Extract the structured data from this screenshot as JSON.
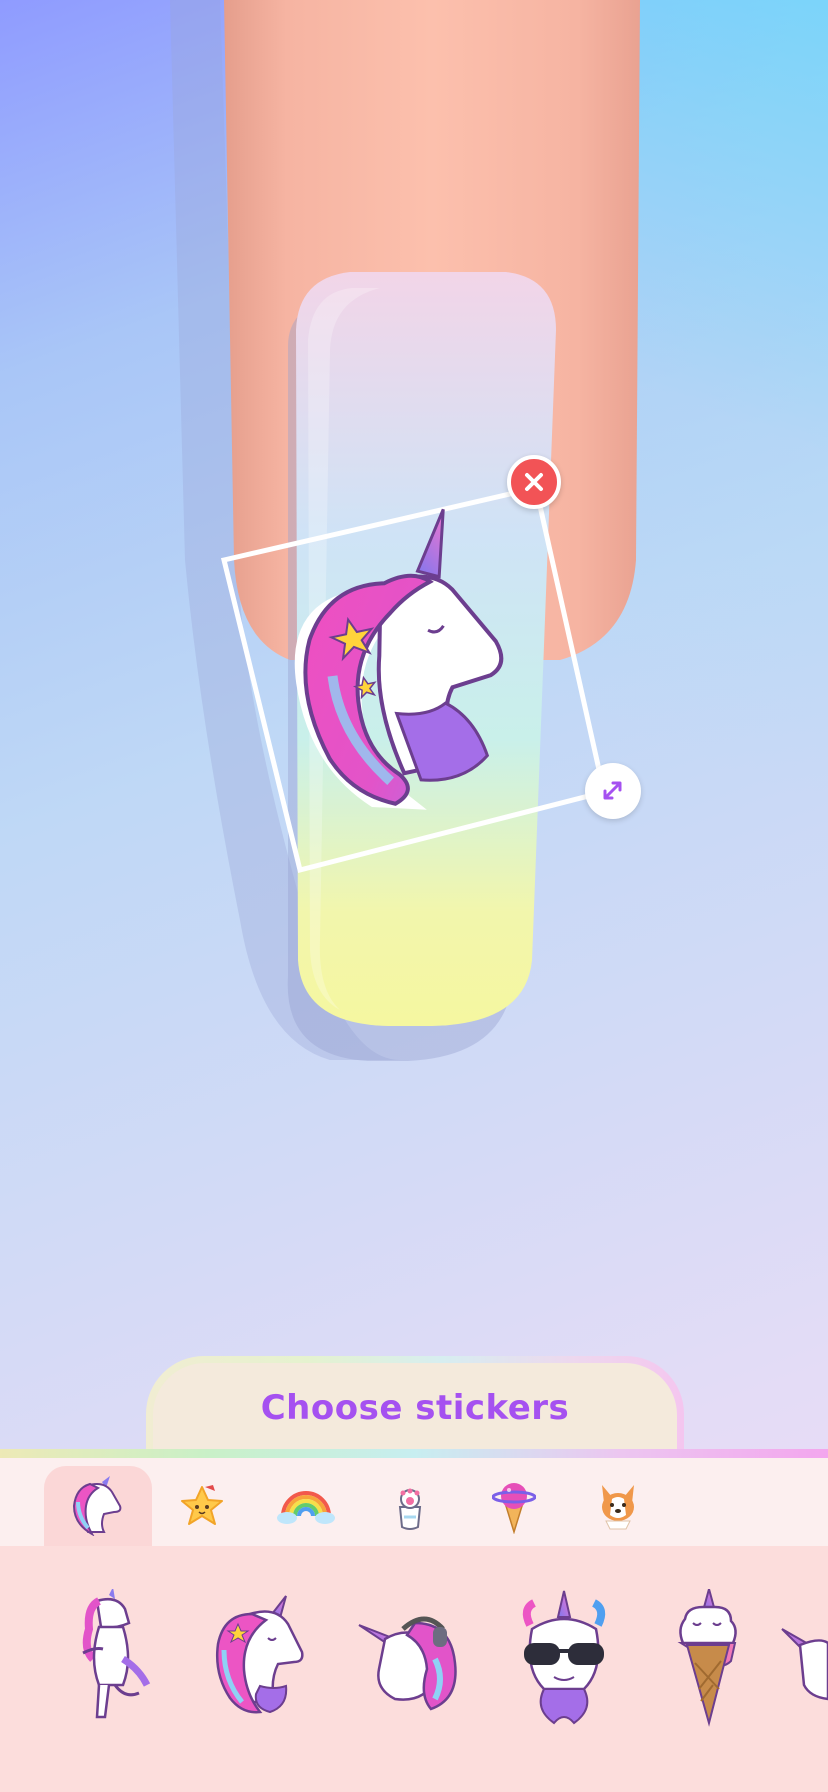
{
  "title": "Choose stickers",
  "colors": {
    "accent": "#a551f0",
    "delete": "#f25356",
    "panel_bg": "#fcdddc",
    "category_bar_bg": "#fcefef",
    "active_tab_bg": "#fbd7d7"
  },
  "editor": {
    "selected_sticker": "unicorn-head-icon",
    "delete_icon": "close-icon",
    "resize_icon": "resize-arrows-icon"
  },
  "categories": [
    {
      "icon": "unicorn-icon",
      "active": true
    },
    {
      "icon": "star-face-icon",
      "active": false
    },
    {
      "icon": "rainbow-icon",
      "active": false
    },
    {
      "icon": "paw-icon",
      "active": false
    },
    {
      "icon": "planet-icecream-icon",
      "active": false
    },
    {
      "icon": "corgi-icon",
      "active": false
    }
  ],
  "stickers": [
    {
      "icon": "dancing-unicorn-icon"
    },
    {
      "icon": "unicorn-head-icon"
    },
    {
      "icon": "unicorn-headphones-icon"
    },
    {
      "icon": "unicorn-sunglasses-icon"
    },
    {
      "icon": "unicorn-icecream-icon"
    },
    {
      "icon": "unicorn-partial-icon"
    }
  ]
}
